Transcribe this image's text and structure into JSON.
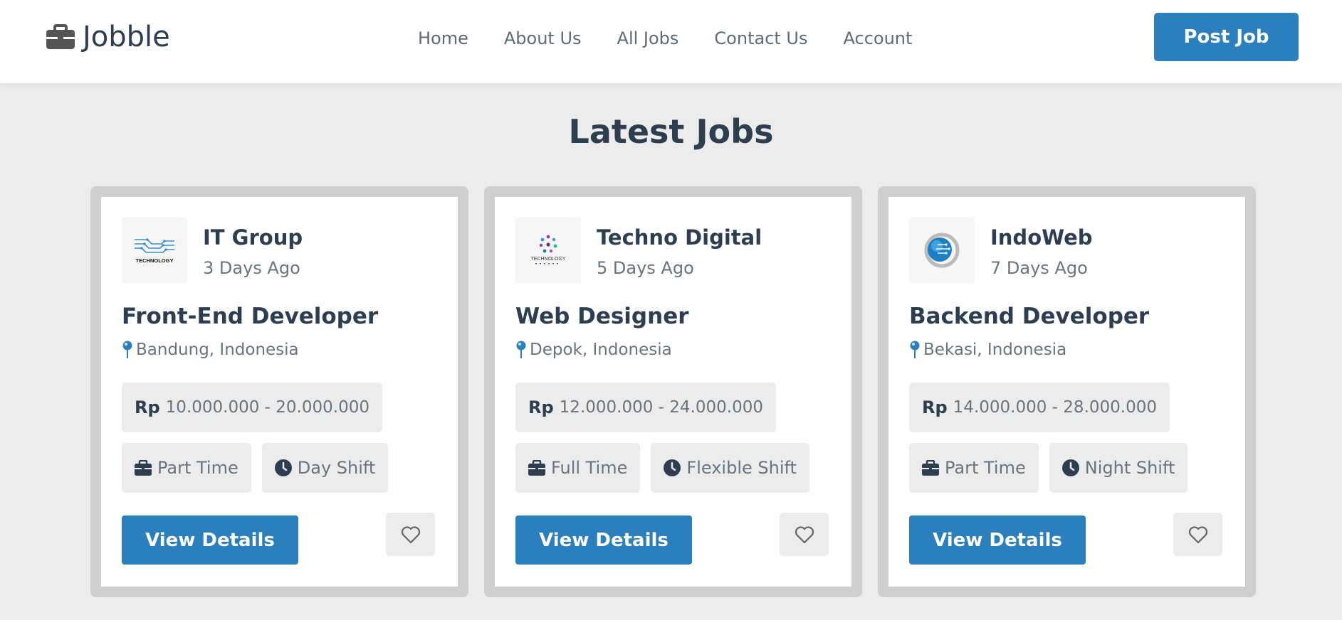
{
  "header": {
    "logo_text": "Jobble",
    "nav": [
      {
        "label": "Home"
      },
      {
        "label": "About Us"
      },
      {
        "label": "All Jobs"
      },
      {
        "label": "Contact Us"
      },
      {
        "label": "Account"
      }
    ],
    "post_button": "Post Job",
    "brand_color": "#2a7fbc"
  },
  "main": {
    "title": "Latest Jobs",
    "jobs": [
      {
        "company": "IT Group",
        "posted": "3 Days Ago",
        "title": "Front-End Developer",
        "location": "Bandung, Indonesia",
        "currency": "Rp",
        "salary": "10.000.000 - 20.000.000",
        "type": "Part Time",
        "shift": "Day Shift",
        "cta": "View Details",
        "logo_text": "TECHNOLOGY"
      },
      {
        "company": "Techno Digital",
        "posted": "5 Days Ago",
        "title": "Web Designer",
        "location": "Depok, Indonesia",
        "currency": "Rp",
        "salary": "12.000.000 - 24.000.000",
        "type": "Full Time",
        "shift": "Flexible Shift",
        "cta": "View Details",
        "logo_text": "TECHNOLOGY"
      },
      {
        "company": "IndoWeb",
        "posted": "7 Days Ago",
        "title": "Backend Developer",
        "location": "Bekasi, Indonesia",
        "currency": "Rp",
        "salary": "14.000.000 - 28.000.000",
        "type": "Part Time",
        "shift": "Night Shift",
        "cta": "View Details"
      }
    ]
  }
}
